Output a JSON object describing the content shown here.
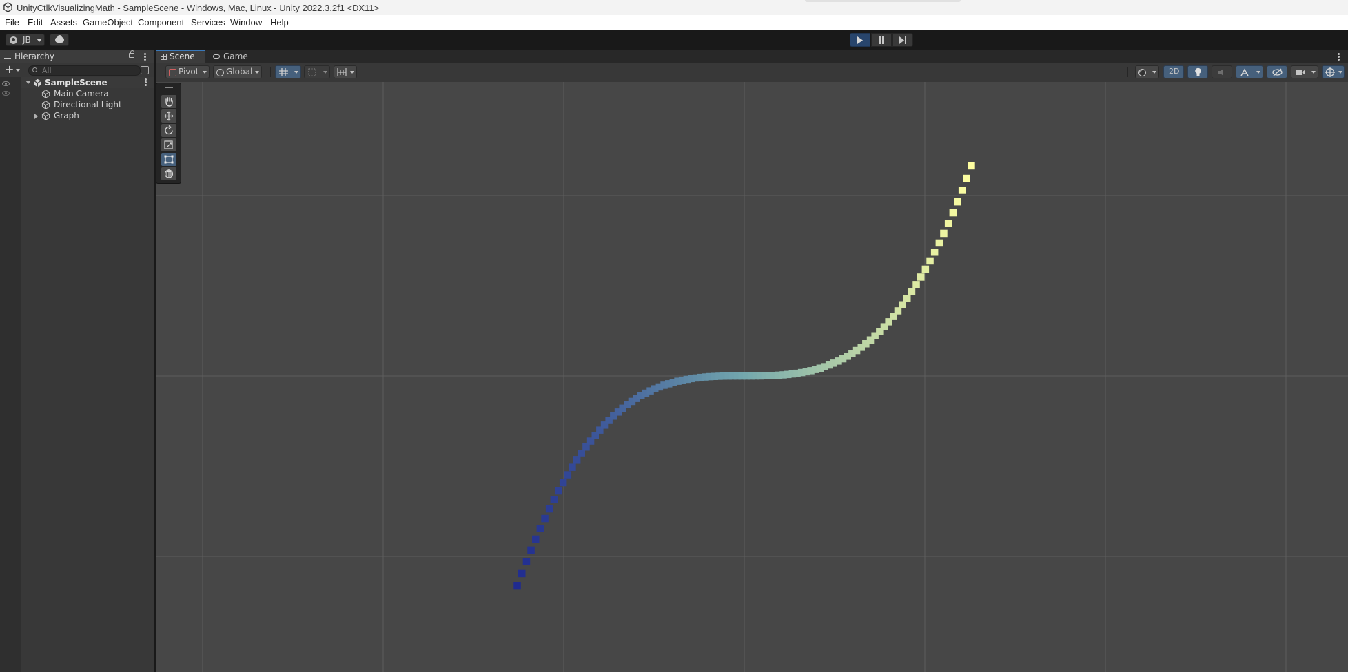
{
  "window": {
    "title": "UnityCtlkVisualizingMath - SampleScene - Windows, Mac, Linux - Unity 2022.3.2f1 <DX11>"
  },
  "menu": [
    "File",
    "Edit",
    "Assets",
    "GameObject",
    "Component",
    "Services",
    "Window",
    "Help"
  ],
  "toolbar": {
    "account_label": "JB",
    "icons": [
      "account-icon",
      "cloud-icon",
      "play-icon",
      "pause-icon",
      "step-icon"
    ],
    "play_active": true
  },
  "hierarchy": {
    "tab_label": "Hierarchy",
    "search_placeholder": "All",
    "scene_name": "SampleScene",
    "items": [
      {
        "label": "Main Camera",
        "expandable": false
      },
      {
        "label": "Directional Light",
        "expandable": false
      },
      {
        "label": "Graph",
        "expandable": true
      }
    ]
  },
  "tabs": {
    "scene": "Scene",
    "game": "Game"
  },
  "scene_toolbar": {
    "pivot": "Pivot",
    "global": "Global",
    "mode_2d": "2D",
    "icons": [
      "grid-snap-icon",
      "snap-increment-icon",
      "grid-icon",
      "shading-icon",
      "lighting-icon",
      "audio-icon",
      "effects-icon",
      "visibility-icon",
      "camera-icon",
      "gizmos-icon"
    ]
  },
  "tools": [
    "view-tool-icon",
    "move-tool-icon",
    "rotate-tool-icon",
    "scale-tool-icon",
    "rect-tool-icon",
    "transform-tool-icon"
  ],
  "active_tool": "rect-tool-icon",
  "graph": {
    "function": "cube",
    "point_count": 100,
    "colors": {
      "low": "#1f2a8f",
      "mid": "#73a7ad",
      "high": "#ffffa0"
    }
  },
  "colors": {
    "accent": "#3a79bb",
    "viewport": "#474747",
    "grid": "#5d5d5d"
  }
}
